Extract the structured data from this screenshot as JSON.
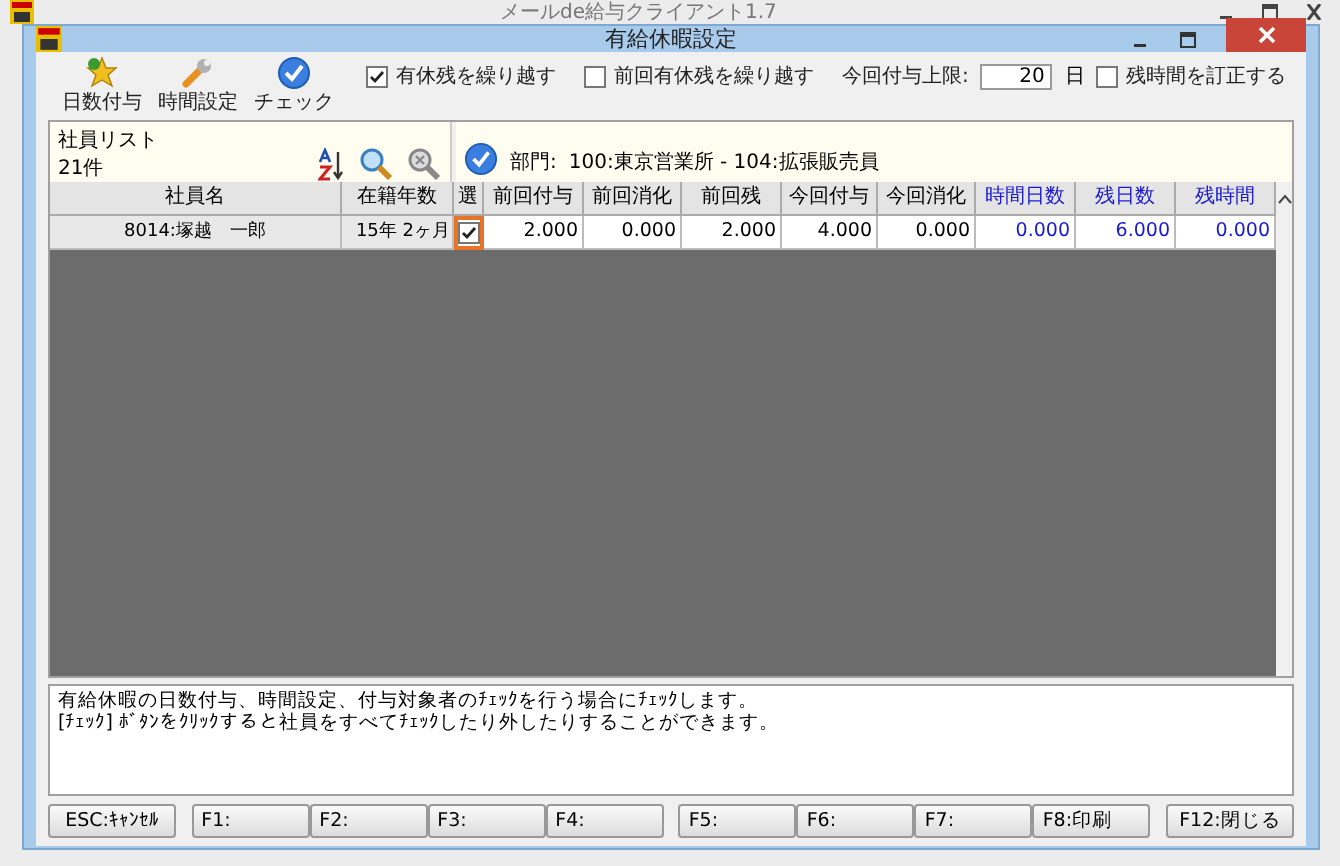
{
  "background_window": {
    "title": "メールde給与クライアント1.7"
  },
  "window": {
    "title": "有給休暇設定"
  },
  "toolbar": [
    {
      "label": "日数付与"
    },
    {
      "label": "時間設定"
    },
    {
      "label": "チェック"
    }
  ],
  "options": [
    {
      "label": "有休残を繰り越す",
      "checked": true
    },
    {
      "label": "前回有休残を繰り越す",
      "checked": false
    }
  ],
  "limit": {
    "label": "今回付与上限:",
    "value": "20",
    "unit": "日"
  },
  "correct_option": {
    "label": "残時間を訂正する",
    "checked": false
  },
  "employee_list": {
    "title": "社員リスト",
    "count": "21件"
  },
  "department": {
    "label": "部門:",
    "value": "100:東京営業所 - 104:拡張販売員"
  },
  "table": {
    "columns": [
      {
        "label": "社員名",
        "color": "#000000"
      },
      {
        "label": "在籍年数",
        "color": "#000000"
      },
      {
        "label": "選",
        "color": "#000000"
      },
      {
        "label": "前回付与",
        "color": "#000000"
      },
      {
        "label": "前回消化",
        "color": "#000000"
      },
      {
        "label": "前回残",
        "color": "#000000"
      },
      {
        "label": "今回付与",
        "color": "#000000"
      },
      {
        "label": "今回消化",
        "color": "#000000"
      },
      {
        "label": "時間日数",
        "color": "#1a1ad0"
      },
      {
        "label": "残日数",
        "color": "#1a1ad0"
      },
      {
        "label": "残時間",
        "color": "#1a1ad0"
      }
    ],
    "rows": [
      {
        "name": "8014:塚越　一郎",
        "tenure": "15年 2ヶ月",
        "checked": true,
        "focused": true,
        "values": [
          "2.000",
          "0.000",
          "2.000",
          "4.000",
          "0.000",
          "0.000",
          "6.000",
          "0.000"
        ]
      }
    ]
  },
  "message": [
    "有給休暇の日数付与、時間設定、付与対象者のﾁｪｯｸを行う場合にﾁｪｯｸします。",
    "[ﾁｪｯｸ] ﾎﾞﾀﾝをｸﾘｯｸすると社員をすべてﾁｪｯｸしたり外したりすることができます。"
  ],
  "function_key_groups": [
    {
      "keys": [
        "ESC:ｷｬﾝｾﾙ"
      ]
    },
    {
      "keys": [
        "F1:",
        "F2:",
        "F3:",
        "F4:"
      ]
    },
    {
      "keys": [
        "F5:",
        "F6:",
        "F7:",
        "F8:印刷"
      ]
    },
    {
      "keys": [
        "F12:閉じる"
      ]
    }
  ]
}
